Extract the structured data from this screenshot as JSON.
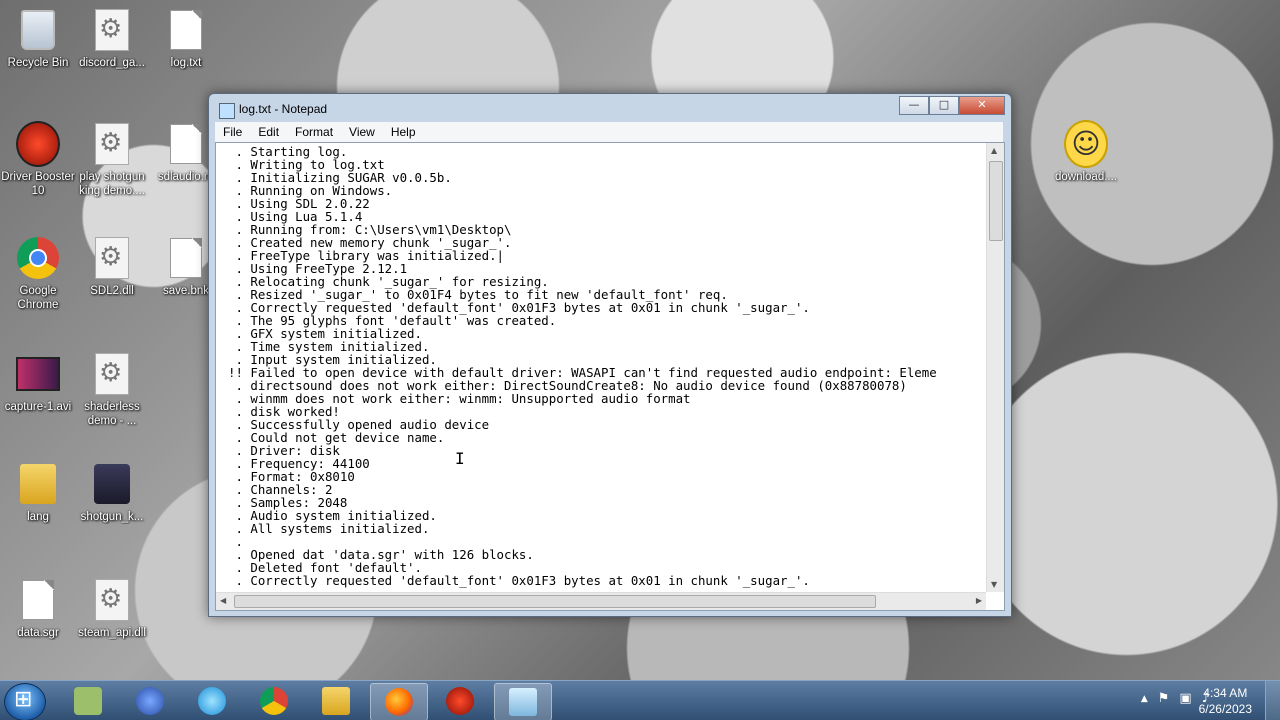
{
  "desktop": {
    "icons": [
      {
        "label": "Recycle Bin"
      },
      {
        "label": "discord_ga..."
      },
      {
        "label": "log.txt"
      },
      {
        "label": "Driver Booster 10"
      },
      {
        "label": "play shotgun king demo...."
      },
      {
        "label": "sdlaudio.ra"
      },
      {
        "label": "Google Chrome"
      },
      {
        "label": "SDL2.dll"
      },
      {
        "label": "save.bnk"
      },
      {
        "label": "capture-1.avi"
      },
      {
        "label": "shaderless demo - ..."
      },
      {
        "label": "lang"
      },
      {
        "label": "shotgun_k..."
      },
      {
        "label": "data.sgr"
      },
      {
        "label": "steam_api.dll"
      },
      {
        "label": "download...."
      }
    ]
  },
  "window": {
    "title": "log.txt - Notepad",
    "buttons": {
      "minimize": "—",
      "maximize": "□",
      "close": "✕"
    },
    "menu": [
      "File",
      "Edit",
      "Format",
      "View",
      "Help"
    ],
    "content": " . Starting log.\n . Writing to log.txt\n . Initializing SUGAR v0.0.5b.\n . Running on Windows.\n . Using SDL 2.0.22\n . Using Lua 5.1.4\n . Running from: C:\\Users\\vm1\\Desktop\\\n . Created new memory chunk '_sugar_'.\n . FreeType library was initialized.|\n . Using FreeType 2.12.1\n . Relocating chunk '_sugar_' for resizing.\n . Resized '_sugar_' to 0x01F4 bytes to fit new 'default_font' req.\n . Correctly requested 'default_font' 0x01F3 bytes at 0x01 in chunk '_sugar_'.\n . The 95 glyphs font 'default' was created.\n . GFX system initialized.\n . Time system initialized.\n . Input system initialized.\n!! Failed to open device with default driver: WASAPI can't find requested audio endpoint: Eleme\n . directsound does not work either: DirectSoundCreate8: No audio device found (0x88780078)\n . winmm does not work either: winmm: Unsupported audio format\n . disk worked!\n . Successfully opened audio device\n . Could not get device name.\n . Driver: disk\n . Frequency: 44100\n . Format: 0x8010\n . Channels: 2\n . Samples: 2048\n . Audio system initialized.\n . All systems initialized.\n .\n . Opened dat 'data.sgr' with 126 blocks.\n . Deleted font 'default'.\n . Correctly requested 'default_font' 0x01F3 bytes at 0x01 in chunk '_sugar_'."
  },
  "taskbar": {
    "clock_time": "4:34 AM",
    "clock_date": "6/26/2023",
    "tray_arrow": "▲"
  }
}
